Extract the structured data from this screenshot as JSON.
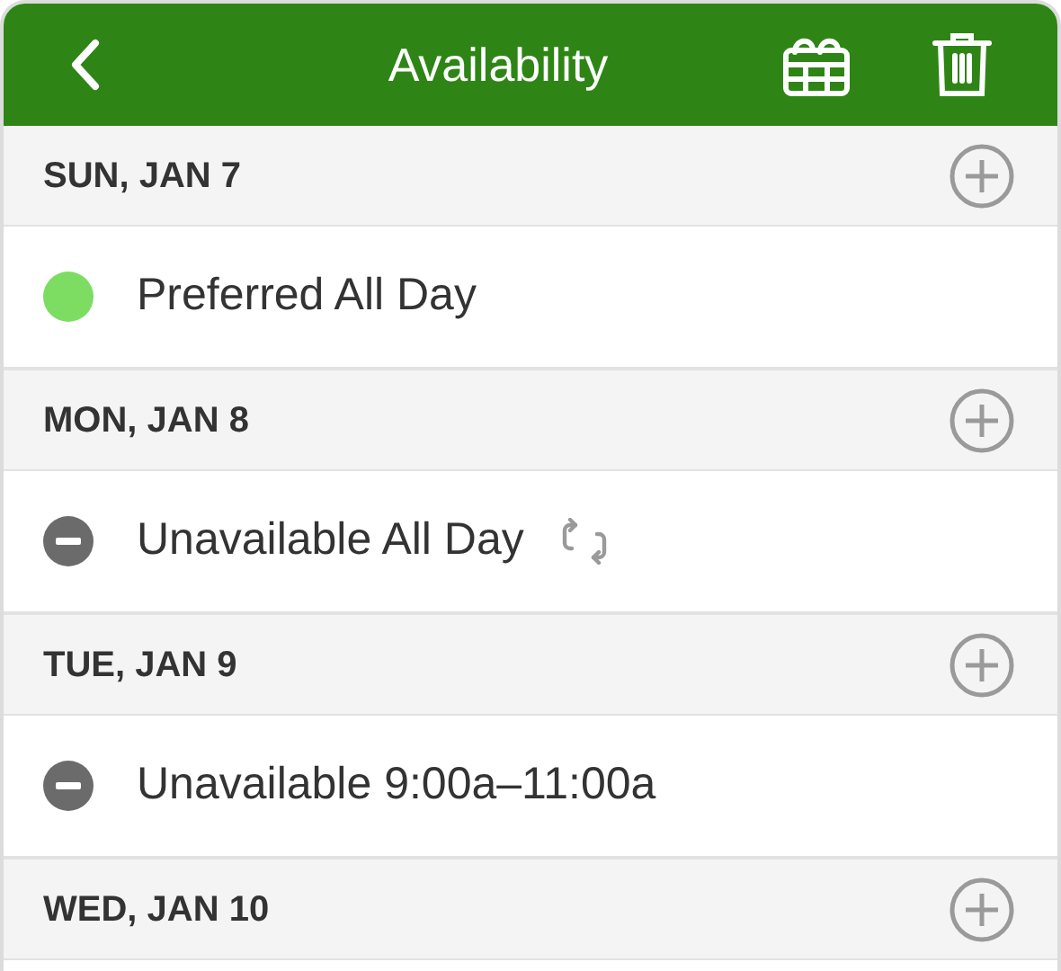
{
  "header": {
    "title": "Availability"
  },
  "days": [
    {
      "label": "SUN, JAN 7",
      "entries": [
        {
          "kind": "preferred",
          "text": "Preferred All Day",
          "repeats": false
        }
      ]
    },
    {
      "label": "MON, JAN 8",
      "entries": [
        {
          "kind": "unavailable",
          "text": "Unavailable All Day",
          "repeats": true
        }
      ]
    },
    {
      "label": "TUE, JAN 9",
      "entries": [
        {
          "kind": "unavailable",
          "text": "Unavailable 9:00a–11:00a",
          "repeats": false
        }
      ]
    },
    {
      "label": "WED, JAN 10"
    }
  ]
}
